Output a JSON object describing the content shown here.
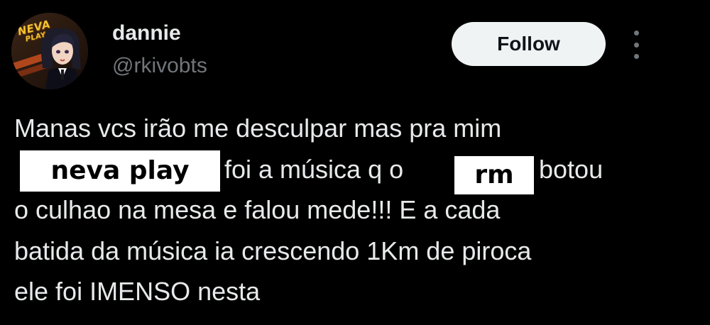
{
  "author": {
    "display_name": "dannie",
    "handle": "@rkivobts",
    "avatar": {
      "icon": "avatar-icon",
      "wordmark": [
        "NEVA",
        "PLAY"
      ]
    }
  },
  "actions": {
    "follow_label": "Follow",
    "more_icon": "more-vertical-icon"
  },
  "tweet": {
    "line1": "Manas vcs irão me desculpar mas pra mim",
    "line2_mid": "foi a música q o",
    "line2_end": "botou",
    "line3": "o culhao na mesa e falou mede!!! E a cada",
    "line4": "batida da música ia crescendo 1Km de piroca",
    "line5": "ele foi IMENSO nesta"
  },
  "overlays": {
    "censor_1": "neva play",
    "censor_2": "rm"
  },
  "colors": {
    "background": "#000000",
    "text_primary": "#e7e9ea",
    "text_secondary": "#71767b",
    "follow_bg": "#eff3f4",
    "follow_text": "#0f1419",
    "avatar_wordmark": "#f2c230"
  }
}
